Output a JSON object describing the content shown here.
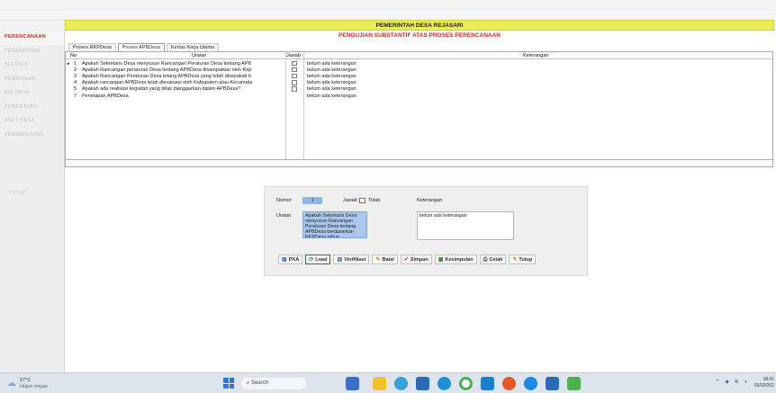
{
  "banner": {
    "title": "PEMERINTAH DESA REJASARI"
  },
  "sidebar": {
    "items": [
      {
        "label": "PERENCANAAN",
        "active": true
      },
      {
        "label": "PENDAPATAN",
        "active": false
      },
      {
        "label": "BELANJA",
        "active": false
      },
      {
        "label": "PEMBINAAN",
        "active": false
      },
      {
        "label": "BSI DESA",
        "active": false
      },
      {
        "label": "PENGAJUAN",
        "active": false
      },
      {
        "label": "ASET DESA",
        "active": false
      },
      {
        "label": "PEMANFAATAN",
        "active": false
      }
    ],
    "tutup": "TUTUP"
  },
  "main": {
    "subtitle": "PENGUJIAN SUBSTANTIF ATAS PROSES PERENCANAAN",
    "tabs": [
      {
        "label": "Proses RKPDesa",
        "active": false
      },
      {
        "label": "Proses APBDesa",
        "active": true
      },
      {
        "label": "Kertas Kerja Utama",
        "active": false
      }
    ],
    "grid": {
      "columns": {
        "no": "No",
        "uraian": "Uraian",
        "jawab": "Jawab",
        "keterangan": "Keterangan"
      },
      "rows": [
        {
          "no": "1",
          "uraian": "Apakah Sekretaris Desa menyusun Rancangan Peraturan Desa tentang APB",
          "keterangan": "belum ada keterangan",
          "checkbox": true,
          "current": true
        },
        {
          "no": "2",
          "uraian": "Apakah Rancangan peraturan Desa tentang APBDesa disampaikan oleh Kep",
          "keterangan": "belum ada keterangan",
          "checkbox": true,
          "current": false
        },
        {
          "no": "3",
          "uraian": "Apakah Rancangan Peraturan Desa tetang APBDesa yang telah disepakati b",
          "keterangan": "belum ada keterangan",
          "checkbox": true,
          "current": false
        },
        {
          "no": "4",
          "uraian": "Apakah rancangan APBDesa telah dievaluasi oleh Kabupaten atau Kecamata",
          "keterangan": "belum ada keterangan",
          "checkbox": true,
          "current": false
        },
        {
          "no": "5",
          "uraian": "Apakah ada realisasi kegiatan yang tidak dianggarkan dalam APBDesa?",
          "keterangan": "belum ada keterangan",
          "checkbox": true,
          "current": false
        },
        {
          "no": "7",
          "uraian": "Penetapan APBDesa",
          "keterangan": "belum ada keterangan",
          "checkbox": false,
          "current": false
        }
      ]
    }
  },
  "form": {
    "nomor_label": "Nomor",
    "nomor_value": "1",
    "jawab_label": "Jawab",
    "tidak_label": "Tidak",
    "keterangan_label": "Keterangan",
    "uraian_label": "Uraian",
    "uraian_value": "Apakah Sekretaris Desa menyusun Rancangan Peraturan Desa tentang APBDesa berdasarkan RKPDesa tahun berkenaan?",
    "keterangan_value": "belum ada keterangan",
    "buttons": {
      "pka": "PKA",
      "load": "Load",
      "verifikasi": "Verifikasi",
      "batal": "Batal",
      "simpan": "Simpan",
      "kesimpulan": "Kesimpulan",
      "cetak": "Cetak",
      "tutup": "Tutup"
    }
  },
  "taskbar": {
    "temperature": "27°C",
    "weather": "Hujan ringan",
    "search_placeholder": "Search",
    "time": "18:41",
    "date": "03/02/202"
  },
  "colors": {
    "accent_red": "#cc2a1a",
    "banner_yellow": "#ecec58",
    "selection_blue": "#aac8ee"
  }
}
